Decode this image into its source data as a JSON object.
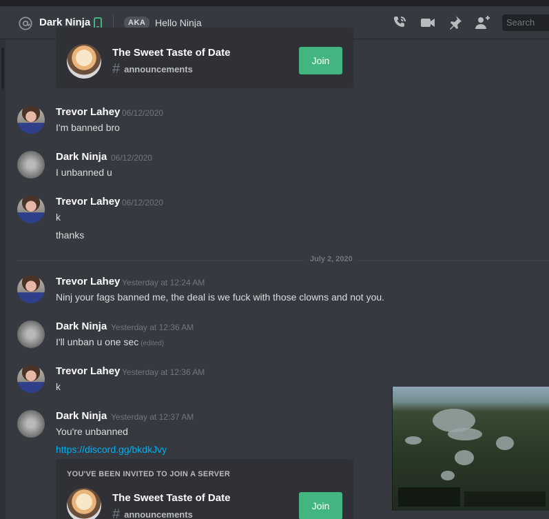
{
  "header": {
    "name": "Dark Ninja",
    "aka": "AKA",
    "nickname": "Hello Ninja",
    "search_placeholder": "Search"
  },
  "invites": [
    {
      "title": "",
      "guild_name": "The Sweet Taste of Date",
      "channel": "announcements",
      "join_label": "Join"
    },
    {
      "title": "You've been invited to join a server",
      "guild_name": "The Sweet Taste of Date",
      "channel": "announcements",
      "join_label": "Join"
    }
  ],
  "date_divider": "July 2, 2020",
  "messages": [
    {
      "author": "Trevor Lahey",
      "timestamp": "06/12/2020",
      "lines": [
        "I'm banned bro"
      ]
    },
    {
      "author": "Dark Ninja",
      "timestamp": "06/12/2020",
      "lines": [
        "I unbanned u"
      ]
    },
    {
      "author": "Trevor Lahey",
      "timestamp": "06/12/2020",
      "lines": [
        "k",
        "thanks"
      ]
    },
    {
      "author": "Trevor Lahey",
      "timestamp": "Yesterday at 12:24 AM",
      "lines": [
        "Ninj your fags banned me, the deal is we fuck with those clowns and not you."
      ]
    },
    {
      "author": "Dark Ninja",
      "timestamp": "Yesterday at 12:36 AM",
      "lines": [
        "I'll unban u one sec"
      ],
      "edited": "(edited)"
    },
    {
      "author": "Trevor Lahey",
      "timestamp": "Yesterday at 12:36 AM",
      "lines": [
        "k"
      ]
    },
    {
      "author": "Dark Ninja",
      "timestamp": "Yesterday at 12:37 AM",
      "lines": [
        "You're unbanned"
      ],
      "link": "https://discord.gg/bkdkJvy"
    }
  ],
  "icons": [
    "at-icon",
    "mobile-icon",
    "call-icon",
    "video-icon",
    "pin-icon",
    "add-member-icon"
  ],
  "colors": {
    "join_green": "#43b581",
    "link_blue": "#00b0f4",
    "bg": "#36393f",
    "embed_bg": "#2f3136"
  }
}
